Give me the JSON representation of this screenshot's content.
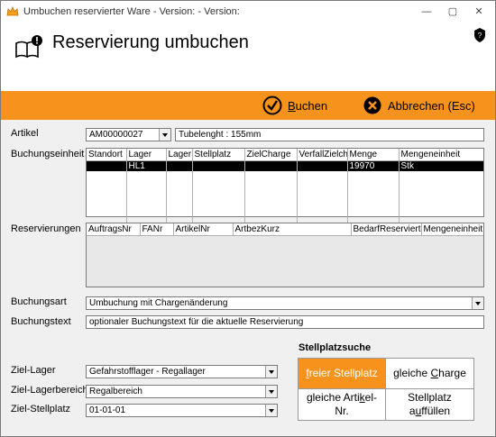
{
  "window": {
    "title": "Umbuchen reservierter Ware - Version:  - Version:",
    "minimize_glyph": "—",
    "maximize_glyph": "▢",
    "close_glyph": "✕"
  },
  "header": {
    "title": "Reservierung umbuchen",
    "icon": "book-alert-icon",
    "shield_icon": "shield-question-icon"
  },
  "toolbar": {
    "buchen": {
      "icon": "check-circle-icon",
      "hotkey": "B",
      "rest": "uchen"
    },
    "abbrechen": {
      "icon": "x-circle-icon",
      "label": "Abbrechen (Esc)"
    }
  },
  "artikel": {
    "label": "Artikel",
    "value": "AM00000027",
    "description": "Tubelenght : 155mm"
  },
  "buchungseinheit": {
    "label": "Buchungseinheit",
    "columns": [
      "Standort",
      "Lager",
      "Lager",
      "Stellplatz",
      "ZielCharge",
      "VerfallZielch",
      "Menge",
      "Mengeneinheit"
    ],
    "rows": [
      [
        "",
        "HL1",
        "",
        "",
        "",
        "",
        "19970",
        "Stk"
      ]
    ]
  },
  "reservierungen": {
    "label": "Reservierungen",
    "columns": [
      "AuftragsNr",
      "FANr",
      "ArtikelNr",
      "ArtbezKurz",
      "BedarfReserviert",
      "Mengeneinheit"
    ]
  },
  "buchungsart": {
    "label": "Buchungsart",
    "value": "Umbuchung mit Chargenänderung"
  },
  "buchungstext": {
    "label": "Buchungstext",
    "value": "optionaler Buchungstext für die aktuelle Reservierung"
  },
  "ziel_lager": {
    "label": "Ziel-Lager",
    "value": "Gefahrstofflager - Regallager"
  },
  "ziel_lagerbereich": {
    "label": "Ziel-Lagerbereich",
    "value": "Regalbereich"
  },
  "ziel_stellplatz": {
    "label": "Ziel-Stellplatz",
    "value": "01-01-01"
  },
  "stellplatzsuche": {
    "title": "Stellplatzsuche",
    "freier": {
      "pre": "",
      "u": "f",
      "post": "reier Stellplatz"
    },
    "gleiche_charge": {
      "pre": "gleiche ",
      "u": "C",
      "post": "harge"
    },
    "gleiche_artikel": {
      "pre": "gleiche Arti",
      "u": "k",
      "post": "el-Nr."
    },
    "auffuellen": {
      "line1": "Stellplatz",
      "pre": "a",
      "u": "u",
      "post": "ffüllen"
    },
    "accent": "#f7931d"
  }
}
